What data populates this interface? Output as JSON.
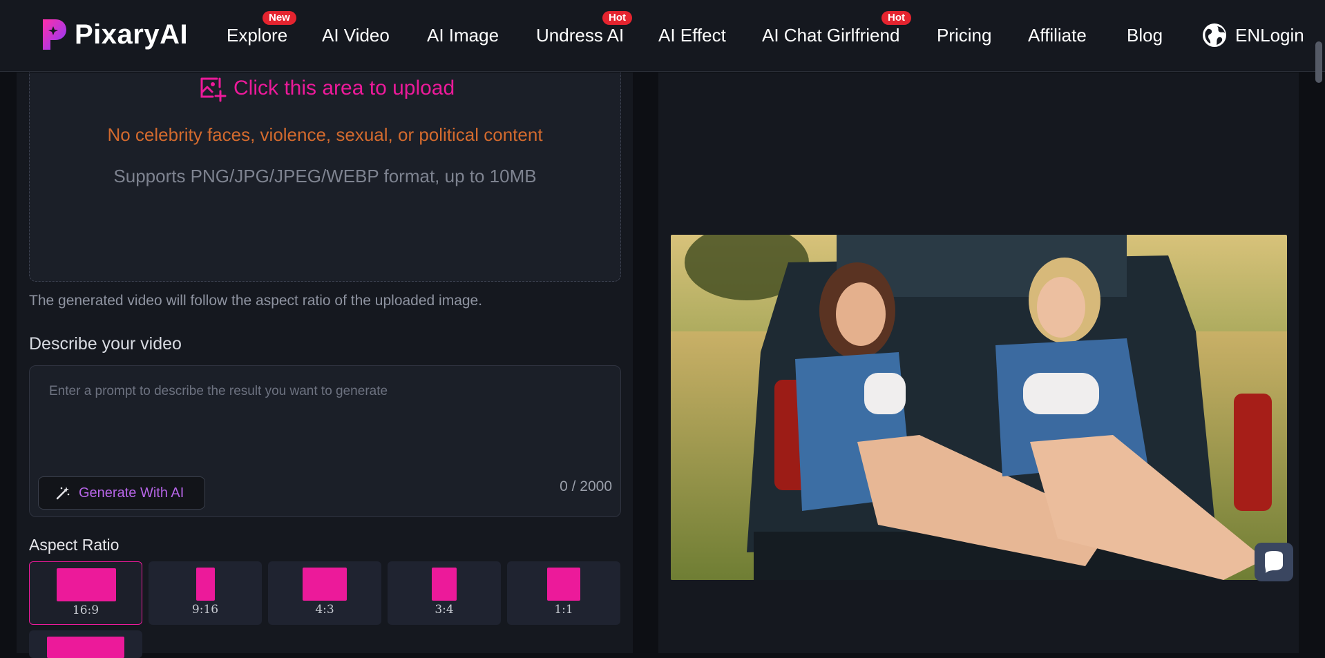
{
  "brand": {
    "name": "PixaryAI",
    "accent": "#ec1a9a"
  },
  "nav": {
    "items": [
      {
        "label": "Explore",
        "badge": "New"
      },
      {
        "label": "AI Video",
        "badge": ""
      },
      {
        "label": "AI Image",
        "badge": ""
      },
      {
        "label": "Undress AI",
        "badge": "Hot"
      },
      {
        "label": "AI Effect",
        "badge": ""
      },
      {
        "label": "AI Chat Girlfriend",
        "badge": "Hot"
      },
      {
        "label": "Pricing",
        "badge": ""
      },
      {
        "label": "Affiliate",
        "badge": ""
      },
      {
        "label": "Blog",
        "badge": ""
      }
    ],
    "language": "EN",
    "login": "Login",
    "icons": {
      "language": "globe-icon"
    }
  },
  "upload": {
    "cta": "Click this area to upload",
    "warning": "No celebrity faces, violence, sexual, or political content",
    "support": "Supports PNG/JPG/JPEG/WEBP format, up to 10MB",
    "icon": "image-add-icon"
  },
  "ratio_note": "The generated video will follow the aspect ratio of the uploaded image.",
  "prompt": {
    "title": "Describe your video",
    "placeholder": "Enter a prompt to describe the result you want to generate",
    "value": "",
    "generate_label": "Generate With AI",
    "generate_icon": "magic-wand-icon",
    "counter": "0 / 2000"
  },
  "aspect_ratio": {
    "title": "Aspect Ratio",
    "selected": "16:9",
    "options": [
      "16:9",
      "9:16",
      "4:3",
      "3:4",
      "1:1"
    ]
  },
  "preview": {
    "icon": "chat-bubble-icon"
  }
}
